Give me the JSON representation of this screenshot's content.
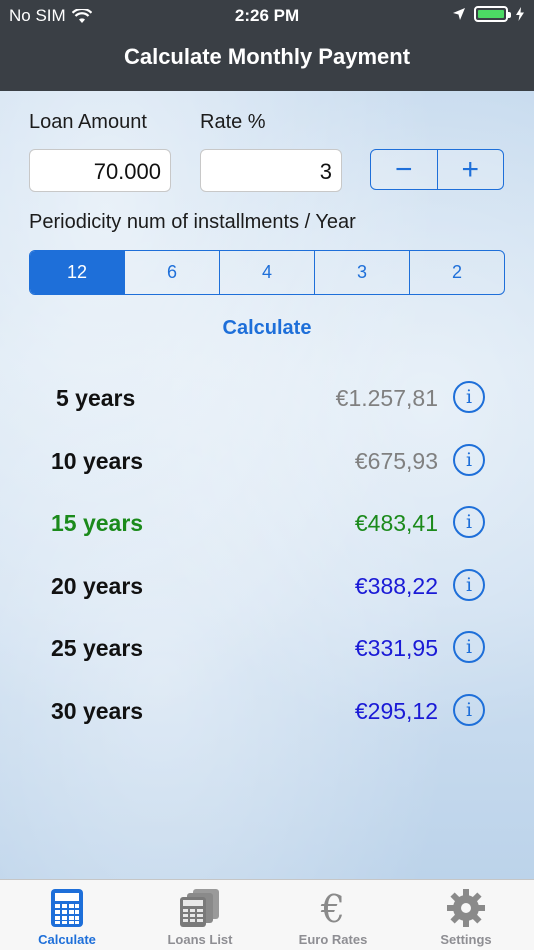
{
  "status_bar": {
    "carrier": "No SIM",
    "time": "2:26 PM"
  },
  "nav": {
    "title": "Calculate Monthly Payment"
  },
  "form": {
    "loan_amount_label": "Loan Amount",
    "rate_label": "Rate %",
    "loan_amount_value": "70.000",
    "rate_value": "3",
    "stepper_minus": "−",
    "stepper_plus": "+",
    "periodicity_label": "Periodicity num of installments / Year",
    "periodicity_options": [
      "12",
      "6",
      "4",
      "3",
      "2"
    ],
    "periodicity_selected": "12",
    "calculate_label": "Calculate"
  },
  "results": [
    {
      "years": "5 years",
      "amount": "€1.257,81",
      "color": "#808080",
      "years_color": "#111111"
    },
    {
      "years": "10 years",
      "amount": "€675,93",
      "color": "#808080",
      "years_color": "#111111"
    },
    {
      "years": "15 years",
      "amount": "€483,41",
      "color": "#1b8a1b",
      "years_color": "#1b8a1b"
    },
    {
      "years": "20 years",
      "amount": "€388,22",
      "color": "#1a1ad6",
      "years_color": "#111111"
    },
    {
      "years": "25 years",
      "amount": "€331,95",
      "color": "#1a1ad6",
      "years_color": "#111111"
    },
    {
      "years": "30 years",
      "amount": "€295,12",
      "color": "#1a1ad6",
      "years_color": "#111111"
    }
  ],
  "info_glyph": "i",
  "tabs": [
    {
      "label": "Calculate",
      "icon": "calculator-icon",
      "active": true
    },
    {
      "label": "Loans List",
      "icon": "loans-list-icon",
      "active": false
    },
    {
      "label": "Euro Rates",
      "icon": "euro-icon",
      "active": false
    },
    {
      "label": "Settings",
      "icon": "gear-icon",
      "active": false
    }
  ],
  "colors": {
    "accent": "#1e6fd9",
    "header_bg": "#3a3f45",
    "battery": "#4cd964"
  }
}
